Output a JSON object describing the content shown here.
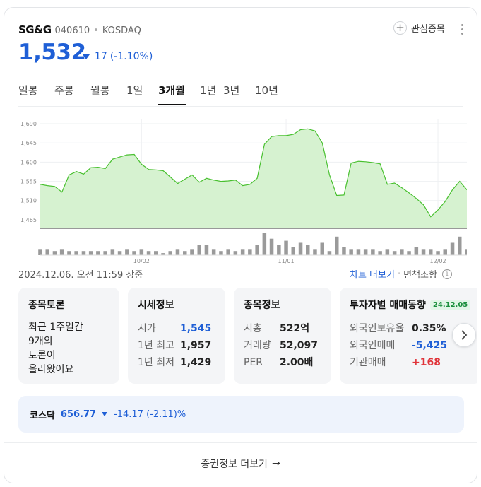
{
  "stock": {
    "name": "SG&G",
    "code": "040610",
    "market": "KOSDAQ",
    "price": "1,532",
    "change_abs": "17",
    "change_pct": "(-1.10%)",
    "watch_label": "관심종목"
  },
  "tabs": [
    {
      "label": "일봉",
      "active": false
    },
    {
      "label": "주봉",
      "active": false
    },
    {
      "label": "월봉",
      "active": false
    },
    {
      "label": "1일",
      "active": false
    },
    {
      "label": "3개월",
      "active": true
    },
    {
      "label": "1년",
      "active": false
    },
    {
      "label": "3년",
      "active": false
    },
    {
      "label": "10년",
      "active": false
    }
  ],
  "chart_data": {
    "type": "area",
    "title": "",
    "ylim": [
      1445,
      1700
    ],
    "y_ticks": [
      "1,690",
      "1,645",
      "1,600",
      "1,555",
      "1,510",
      "1,465"
    ],
    "y_tick_values": [
      1690,
      1645,
      1600,
      1555,
      1510,
      1465
    ],
    "x_tick_labels": [
      "10/02",
      "11/01",
      "12/02"
    ],
    "x_tick_indices": [
      14,
      34,
      55
    ],
    "values": [
      1548,
      1545,
      1543,
      1530,
      1570,
      1578,
      1572,
      1587,
      1588,
      1585,
      1607,
      1612,
      1617,
      1618,
      1595,
      1583,
      1582,
      1580,
      1565,
      1550,
      1560,
      1570,
      1553,
      1562,
      1558,
      1555,
      1556,
      1558,
      1545,
      1548,
      1562,
      1642,
      1660,
      1662,
      1662,
      1665,
      1676,
      1678,
      1673,
      1645,
      1570,
      1522,
      1523,
      1598,
      1602,
      1601,
      1599,
      1596,
      1548,
      1551,
      1540,
      1528,
      1515,
      1500,
      1472,
      1488,
      1508,
      1535,
      1555,
      1535
    ],
    "volume": [
      3,
      3,
      2,
      3,
      2,
      2,
      2,
      2,
      2,
      2,
      3,
      2,
      3,
      2,
      3,
      2,
      2,
      1,
      2,
      3,
      2,
      3,
      5,
      5,
      3,
      2,
      3,
      2,
      3,
      3,
      5,
      11,
      8,
      5,
      7,
      4,
      6,
      5,
      3,
      6,
      2,
      9,
      4,
      3,
      3,
      3,
      3,
      2,
      3,
      2,
      3,
      2,
      4,
      3,
      3,
      2,
      3,
      6,
      9,
      3
    ],
    "line_color": "#48c02f",
    "fill_color": "#d6f2d0",
    "volume_color": "#9a9a9a"
  },
  "datetime": "2024.12.06. 오전 11:59 장중",
  "chart_more": "차트 더보기",
  "sep": "·",
  "disclaimer": "면책조항",
  "discussion": {
    "title": "종목토론",
    "line1": "최근 1주일간",
    "line2": "9개의",
    "line3": "토론이",
    "line4": "올라왔어요"
  },
  "quote": {
    "title": "시세정보",
    "rows": [
      {
        "k": "시가",
        "v": "1,545"
      },
      {
        "k": "1년 최고",
        "v": "1,957"
      },
      {
        "k": "1년 최저",
        "v": "1,429"
      }
    ]
  },
  "stockinfo": {
    "title": "종목정보",
    "rows": [
      {
        "k": "시총",
        "v": "522억"
      },
      {
        "k": "거래량",
        "v": "52,097"
      },
      {
        "k": "PER",
        "v": "2.00배"
      }
    ]
  },
  "investor": {
    "title": "투자자별 매매동향",
    "date": "24.12.05",
    "rows": [
      {
        "k": "외국인보유율",
        "v": "0.35%"
      },
      {
        "k": "외국인매매",
        "v": "-5,425"
      },
      {
        "k": "기관매매",
        "v": "+168"
      }
    ]
  },
  "kosdaq": {
    "name": "코스닥",
    "value": "656.77",
    "change": "-14.17 (-2.11)%"
  },
  "footer": {
    "label": "증권정보 더보기",
    "arrow": "→"
  },
  "colors": {
    "accent": "#1f5fd6",
    "down": "#1f5fd6",
    "up": "#e0343a"
  }
}
